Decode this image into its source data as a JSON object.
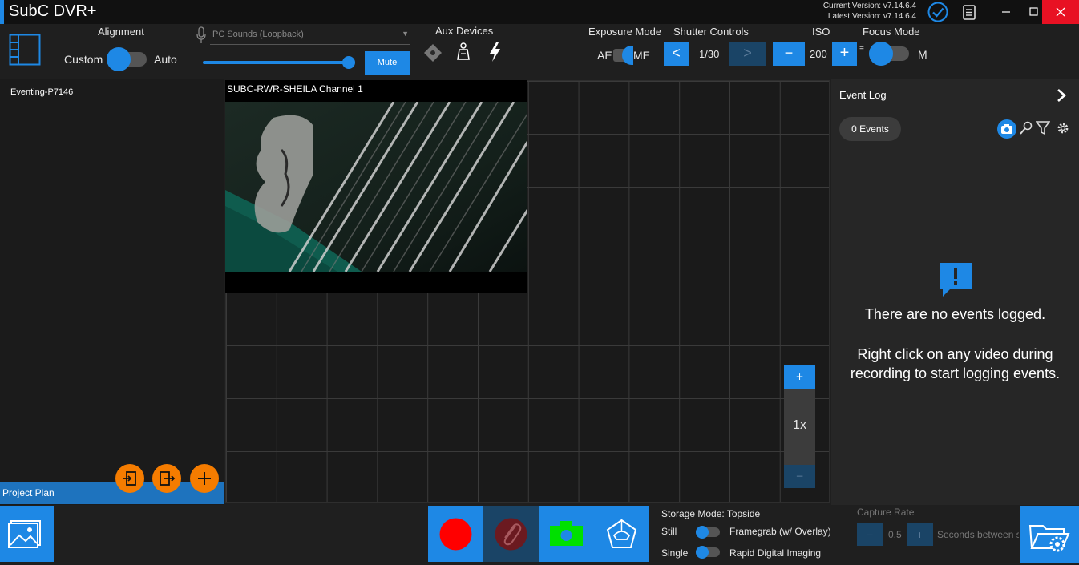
{
  "window": {
    "title": "SubC DVR+",
    "current_version": "Current Version: v7.14.6.4",
    "latest_version": "Latest Version: v7.14.6.4"
  },
  "toolbar": {
    "alignment_label": "Alignment",
    "alignment_left": "Custom",
    "alignment_right": "Auto",
    "audio_source": "PC Sounds (Loopback)",
    "audio_volume_fraction": 0.97,
    "mute_label": "Mute",
    "aux_devices_label": "Aux Devices",
    "exposure_label": "Exposure Mode",
    "exposure_left": "AE",
    "exposure_right": "ME",
    "shutter_label": "Shutter Controls",
    "shutter_prev": "<",
    "shutter_value": "1/30",
    "shutter_next": ">",
    "iso_label": "ISO",
    "iso_minus": "−",
    "iso_value": "200",
    "iso_plus": "+",
    "focus_label": "Focus Mode",
    "focus_left": "=",
    "focus_right": "M"
  },
  "left_panel": {
    "project_item": "Eventing-P7146",
    "project_plan": "Project Plan"
  },
  "video": {
    "title": "SUBC-RWR-SHEILA Channel 1"
  },
  "zoom": {
    "plus": "+",
    "level": "1x",
    "minus": "−"
  },
  "event_log": {
    "title": "Event Log",
    "count_badge": "0  Events",
    "empty_title": "There are no events logged.",
    "empty_hint_line1": "Right click on any video during",
    "empty_hint_line2": "recording to start logging events."
  },
  "bottom": {
    "storage_mode": "Storage Mode: Topside",
    "still_label": "Still",
    "still_option": "Framegrab (w/ Overlay)",
    "single_label": "Single",
    "single_option": "Rapid Digital Imaging",
    "capture_rate_label": "Capture Rate",
    "capture_minus": "−",
    "capture_value": "0.5",
    "capture_plus": "+",
    "capture_unit": "Seconds between s"
  },
  "colors": {
    "accent": "#1e88e5",
    "record": "#ff0000",
    "snapshot": "#00e000",
    "orange": "#f57c00",
    "close": "#e81123"
  }
}
